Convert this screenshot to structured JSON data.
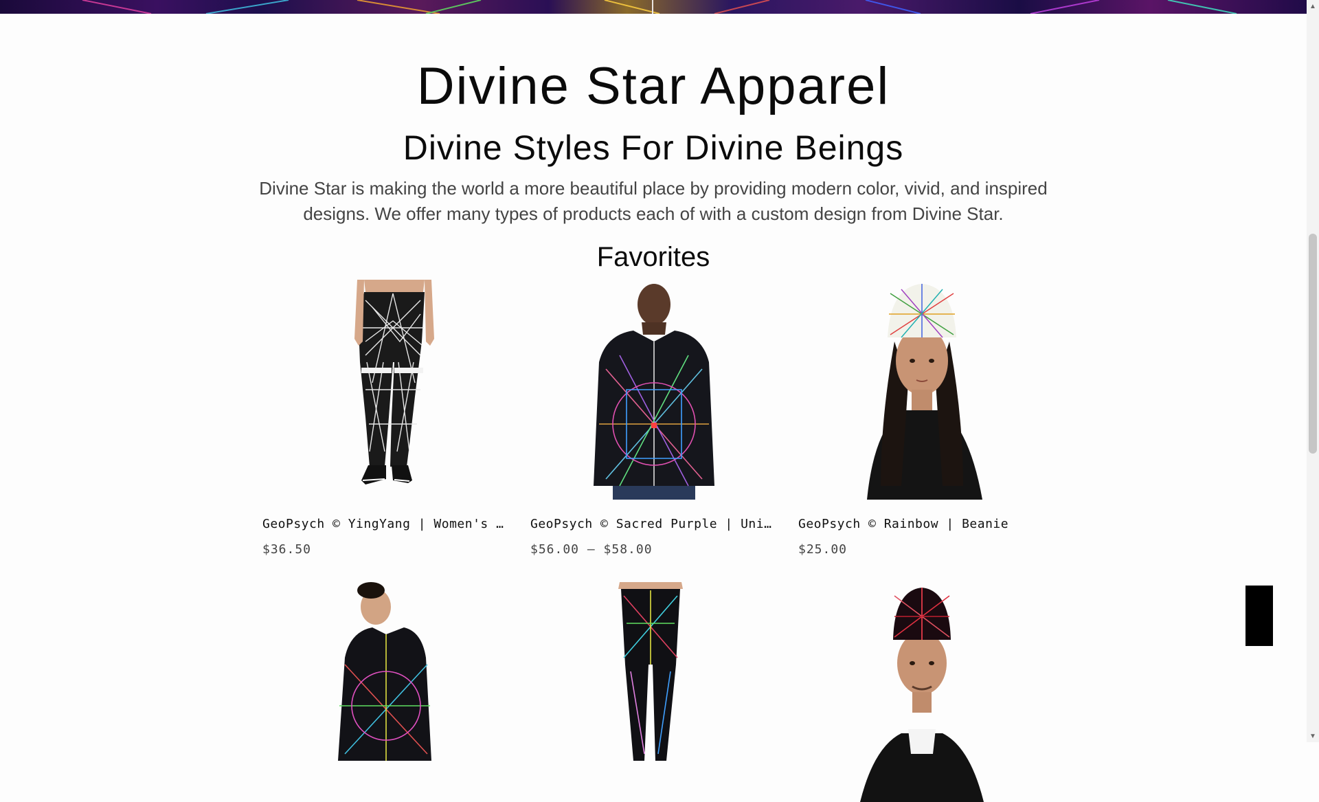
{
  "page": {
    "title": "Divine Star Apparel",
    "tagline": "Divine Styles For Divine Beings",
    "intro": "Divine Star is making the world a more beautiful place by providing modern color, vivid, and inspired designs. We offer many types of products each of with a custom design from Divine Star.",
    "section_heading": "Favorites"
  },
  "products": [
    {
      "name": "GeoPsych © YingYang | Women's Leg...",
      "price": "$36.50",
      "image": "black-white-leggings"
    },
    {
      "name": "GeoPsych © Sacred Purple | Unisex ...",
      "price": "$56.00 – $58.00",
      "image": "geometric-hoodie"
    },
    {
      "name": "GeoPsych © Rainbow | Beanie",
      "price": "$25.00",
      "image": "rainbow-beanie"
    },
    {
      "name": "",
      "price": "",
      "image": "rainbow-hoodie"
    },
    {
      "name": "",
      "price": "",
      "image": "rainbow-leggings"
    },
    {
      "name": "",
      "price": "",
      "image": "red-beanie"
    }
  ],
  "colors": {
    "background": "#fdfdfd",
    "text": "#111111",
    "muted_text": "#444444",
    "floating_button": "#000000"
  }
}
